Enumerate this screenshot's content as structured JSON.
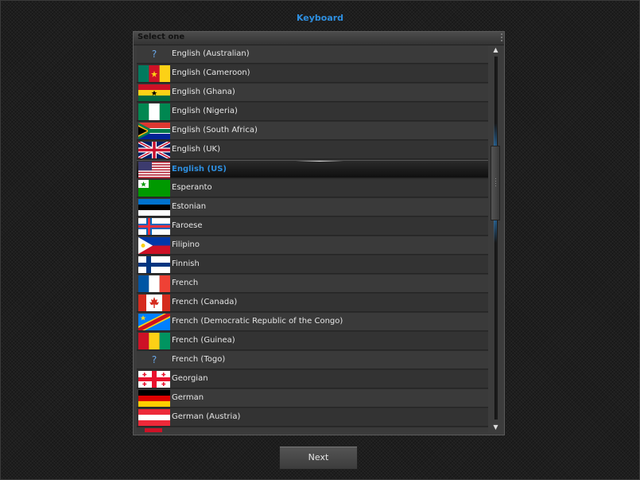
{
  "window": {
    "title": "Keyboard"
  },
  "panel": {
    "header": "Select one"
  },
  "languages": [
    {
      "label": "English (Australian)",
      "flag": "unknown",
      "selected": false
    },
    {
      "label": "English (Cameroon)",
      "flag": "cameroon",
      "selected": false
    },
    {
      "label": "English (Ghana)",
      "flag": "ghana",
      "selected": false
    },
    {
      "label": "English (Nigeria)",
      "flag": "nigeria",
      "selected": false
    },
    {
      "label": "English (South Africa)",
      "flag": "south-africa",
      "selected": false
    },
    {
      "label": "English (UK)",
      "flag": "uk",
      "selected": false
    },
    {
      "label": "English (US)",
      "flag": "us",
      "selected": true
    },
    {
      "label": "Esperanto",
      "flag": "esperanto",
      "selected": false
    },
    {
      "label": "Estonian",
      "flag": "estonia",
      "selected": false
    },
    {
      "label": "Faroese",
      "flag": "faroe",
      "selected": false
    },
    {
      "label": "Filipino",
      "flag": "philippines",
      "selected": false
    },
    {
      "label": "Finnish",
      "flag": "finland",
      "selected": false
    },
    {
      "label": "French",
      "flag": "france",
      "selected": false
    },
    {
      "label": "French (Canada)",
      "flag": "canada",
      "selected": false
    },
    {
      "label": "French (Democratic Republic of the Congo)",
      "flag": "drc",
      "selected": false
    },
    {
      "label": "French (Guinea)",
      "flag": "guinea",
      "selected": false
    },
    {
      "label": "French (Togo)",
      "flag": "unknown",
      "selected": false
    },
    {
      "label": "Georgian",
      "flag": "georgia",
      "selected": false
    },
    {
      "label": "German",
      "flag": "germany",
      "selected": false
    },
    {
      "label": "German (Austria)",
      "flag": "austria",
      "selected": false
    },
    {
      "label": "",
      "flag": "partial-red",
      "selected": false
    }
  ],
  "icons": {
    "unknown_flag": "?",
    "scroll_up": "▲",
    "scroll_down": "▼"
  },
  "scroll": {
    "position": 0.4
  },
  "buttons": {
    "next": "Next"
  },
  "colors": {
    "accent": "#2e8fe0",
    "text": "#e6e6e6"
  }
}
